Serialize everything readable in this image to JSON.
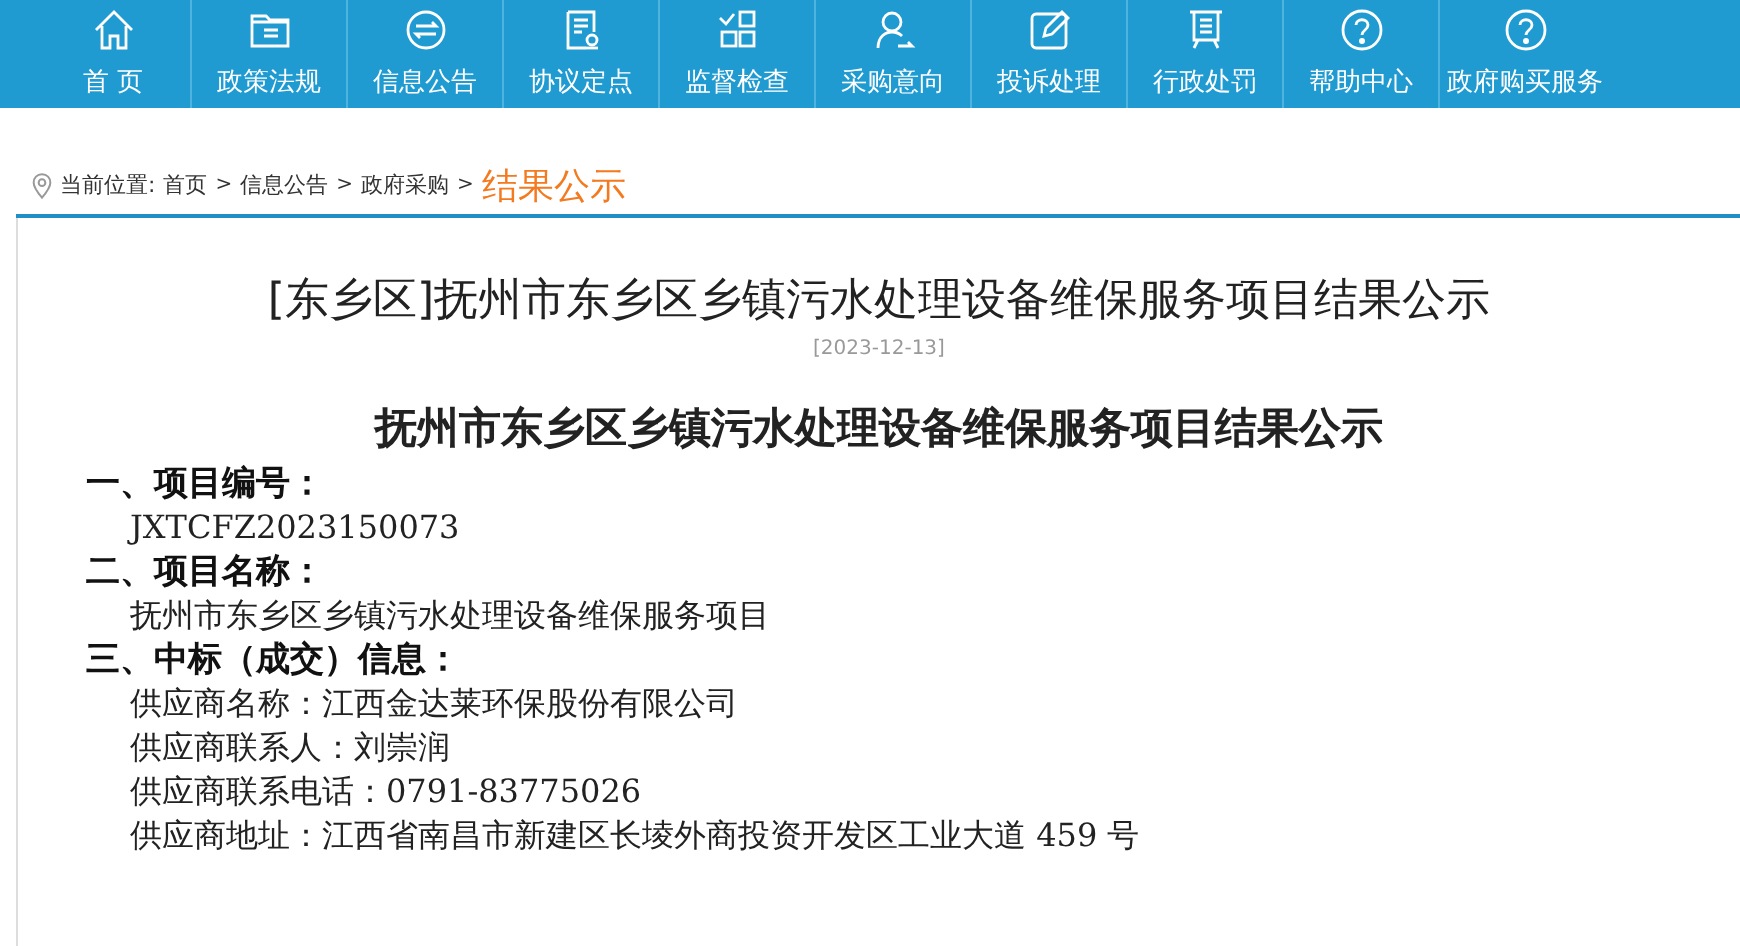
{
  "nav": {
    "items": [
      {
        "label": "首 页"
      },
      {
        "label": "政策法规"
      },
      {
        "label": "信息公告"
      },
      {
        "label": "协议定点"
      },
      {
        "label": "监督检查"
      },
      {
        "label": "采购意向"
      },
      {
        "label": "投诉处理"
      },
      {
        "label": "行政处罚"
      },
      {
        "label": "帮助中心"
      },
      {
        "label": "政府购买服务"
      }
    ]
  },
  "breadcrumb": {
    "prefix": "当前位置:",
    "links": [
      "首页",
      "信息公告",
      "政府采购"
    ],
    "separator": ">",
    "current": "结果公示"
  },
  "article": {
    "title": "[东乡区]抚州市东乡区乡镇污水处理设备维保服务项目结果公示",
    "date": "[2023-12-13]",
    "heading": "抚州市东乡区乡镇污水处理设备维保服务项目结果公示",
    "sections": [
      {
        "heading": "一、项目编号：",
        "lines": [
          "JXTCFZ2023150073"
        ]
      },
      {
        "heading": "二、项目名称：",
        "lines": [
          "抚州市东乡区乡镇污水处理设备维保服务项目"
        ]
      },
      {
        "heading": "三、中标（成交）信息：",
        "lines": [
          "供应商名称：江西金达莱环保股份有限公司",
          "供应商联系人：刘崇润",
          "供应商联系电话：0791-83775026",
          "供应商地址：江西省南昌市新建区长堎外商投资开发区工业大道 459 号"
        ]
      }
    ]
  }
}
